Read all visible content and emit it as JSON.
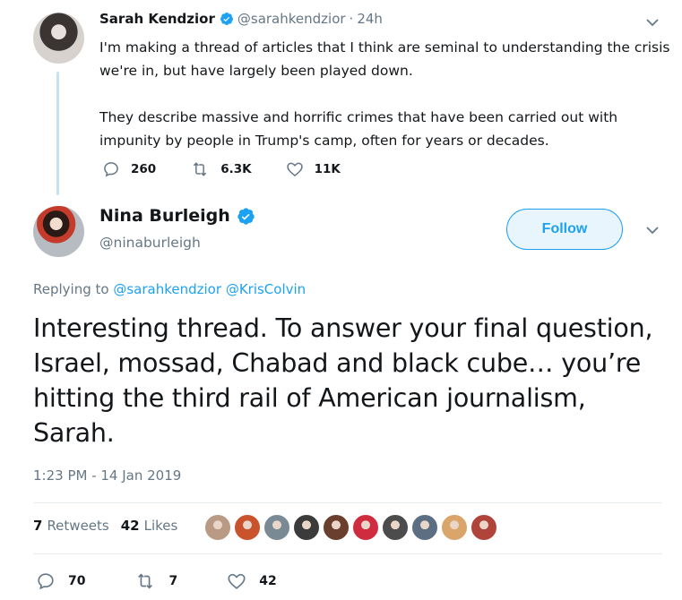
{
  "parent_tweet": {
    "name": "Sarah Kendzior",
    "handle": "@sarahkendzior",
    "separator": "·",
    "time": "24h",
    "paragraphs": [
      "I'm making a thread of articles that I think are seminal to understanding the crisis we're in, but have largely been played down.",
      "They describe massive and horrific crimes that have been carried out with impunity by people in Trump's camp, often for years or decades."
    ],
    "replies": "260",
    "retweets": "6.3K",
    "likes": "11K"
  },
  "tweet": {
    "name": "Nina Burleigh",
    "handle": "@ninaburleigh",
    "follow_label": "Follow",
    "replying_prefix": "Replying to",
    "replying_to": [
      "@sarahkendzior",
      "@KrisColvin"
    ],
    "text": "Interesting thread. To answer your final question, Israel, mossad, Chabad and black cube… you’re hitting the third rail of American journalism, Sarah.",
    "timestamp": "1:23 PM - 14 Jan 2019",
    "retweet_count": "7",
    "retweet_label": "Retweets",
    "like_count": "42",
    "like_label": "Likes",
    "replies": "70",
    "retweets": "7",
    "likes": "42"
  },
  "liker_avatar_colors": [
    "#b89a85",
    "#c8532c",
    "#7a8a94",
    "#3b3b3b",
    "#6b3f2e",
    "#cf2d3f",
    "#4c4c4c",
    "#5c6f82",
    "#d9a56b",
    "#b0443a"
  ],
  "colors": {
    "accent": "#1da1f2",
    "secondary_text": "#657786",
    "thread_line": "#c4e2f6"
  },
  "icons": {
    "verified": "verified-badge-icon",
    "menu": "chevron-down-icon",
    "reply": "reply-icon",
    "retweet": "retweet-icon",
    "like": "heart-icon"
  }
}
